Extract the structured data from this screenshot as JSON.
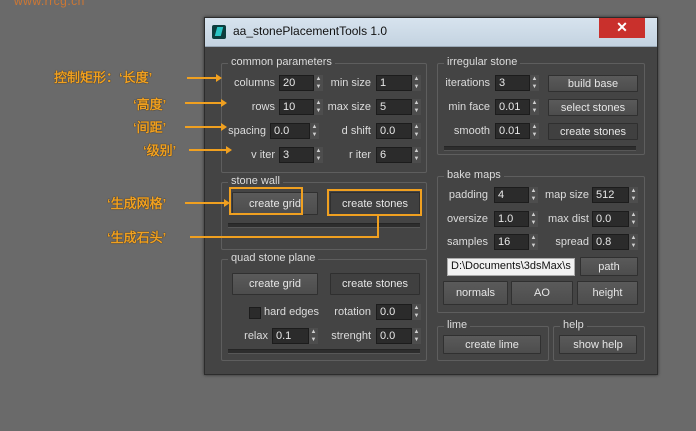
{
  "watermark": "www.rrcg.cn",
  "window": {
    "title": "aa_stonePlacementTools 1.0",
    "close_label": "✕"
  },
  "common": {
    "title": "common parameters",
    "columns": {
      "label": "columns",
      "value": "20"
    },
    "min_size": {
      "label": "min size",
      "value": "1"
    },
    "rows": {
      "label": "rows",
      "value": "10"
    },
    "max_size": {
      "label": "max size",
      "value": "5"
    },
    "spacing": {
      "label": "spacing",
      "value": "0.0"
    },
    "d_shift": {
      "label": "d shift",
      "value": "0.0"
    },
    "v_iter": {
      "label": "v iter",
      "value": "3"
    },
    "r_iter": {
      "label": "r iter",
      "value": "6"
    }
  },
  "stone_wall": {
    "title": "stone wall",
    "create_grid": "create grid",
    "create_stones": "create stones"
  },
  "quad": {
    "title": "quad stone plane",
    "create_grid": "create grid",
    "create_stones": "create stones",
    "hard_edges": "hard edges",
    "rotation": {
      "label": "rotation",
      "value": "0.0"
    },
    "relax": {
      "label": "relax",
      "value": "0.1"
    },
    "strenght": {
      "label": "strenght",
      "value": "0.0"
    }
  },
  "irregular": {
    "title": "irregular stone",
    "iterations": {
      "label": "iterations",
      "value": "3"
    },
    "min_face": {
      "label": "min face",
      "value": "0.01"
    },
    "smooth": {
      "label": "smooth",
      "value": "0.01"
    },
    "build_base": "build base",
    "select_stones": "select stones",
    "create_stones": "create stones"
  },
  "bake": {
    "title": "bake maps",
    "padding": {
      "label": "padding",
      "value": "4"
    },
    "map_size": {
      "label": "map size",
      "value": "512"
    },
    "oversize": {
      "label": "oversize",
      "value": "1.0"
    },
    "max_dist": {
      "label": "max dist",
      "value": "0.0"
    },
    "samples": {
      "label": "samples",
      "value": "16"
    },
    "spread": {
      "label": "spread",
      "value": "0.8"
    },
    "path_value": "D:\\Documents\\3dsMax\\s",
    "path_button": "path",
    "normals": "normals",
    "ao": "AO",
    "height": "height"
  },
  "lime": {
    "title": "lime",
    "button": "create lime"
  },
  "help": {
    "title": "help",
    "button": "show help"
  },
  "annotations": {
    "length": "控制矩形：‘长度’",
    "height": "‘高度’",
    "spacing": "‘间距’",
    "level": "‘级别’",
    "grid": "‘生成网格’",
    "stones": "‘生成石头’"
  },
  "colors": {
    "annotation": "#f0a020",
    "panel": "#444444",
    "field": "#2b2b2b",
    "close": "#c9302c"
  }
}
